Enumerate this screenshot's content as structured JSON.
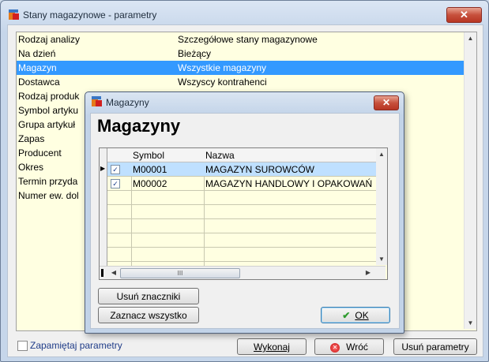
{
  "window": {
    "title": "Stany magazynowe - parametry",
    "close_glyph": "✕"
  },
  "params": [
    {
      "key": "Rodzaj analizy",
      "value": "Szczegółowe stany magazynowe"
    },
    {
      "key": "Na dzień",
      "value": "Bieżący"
    },
    {
      "key": "Magazyn",
      "value": "Wszystkie magazyny"
    },
    {
      "key": "Dostawca",
      "value": "Wszyscy kontrahenci"
    },
    {
      "key": "Rodzaj produk",
      "value": ""
    },
    {
      "key": "Symbol artyku",
      "value": ""
    },
    {
      "key": "Grupa artykuł",
      "value": ""
    },
    {
      "key": "Zapas",
      "value": ""
    },
    {
      "key": "Producent",
      "value": ""
    },
    {
      "key": "Okres",
      "value": ""
    },
    {
      "key": "Termin przyda",
      "value": ""
    },
    {
      "key": "Numer ew. dol",
      "value": ""
    }
  ],
  "selected_param": "Magazyn",
  "footer": {
    "remember_label": "Zapamiętaj parametry",
    "run_label": "Wykonaj",
    "back_label": "Wróć",
    "delete_label": "Usuń parametry"
  },
  "dialog": {
    "title": "Magazyny",
    "heading": "Magazyny",
    "close_glyph": "✕",
    "columns": {
      "symbol": "Symbol",
      "name": "Nazwa"
    },
    "rows": [
      {
        "checked": true,
        "symbol": "M00001",
        "name": "MAGAZYN SUROWCÓW"
      },
      {
        "checked": true,
        "symbol": "M00002",
        "name": "MAGAZYN HANDLOWY I OPAKOWAŃ"
      }
    ],
    "scroll_grip": "III",
    "clear_label": "Usuń znaczniki",
    "select_all_label": "Zaznacz wszystko",
    "ok_label": "OK"
  },
  "colors": {
    "selection": "#3399ff",
    "list_background": "#ffffe1",
    "heading_link": "#1f3c88"
  }
}
